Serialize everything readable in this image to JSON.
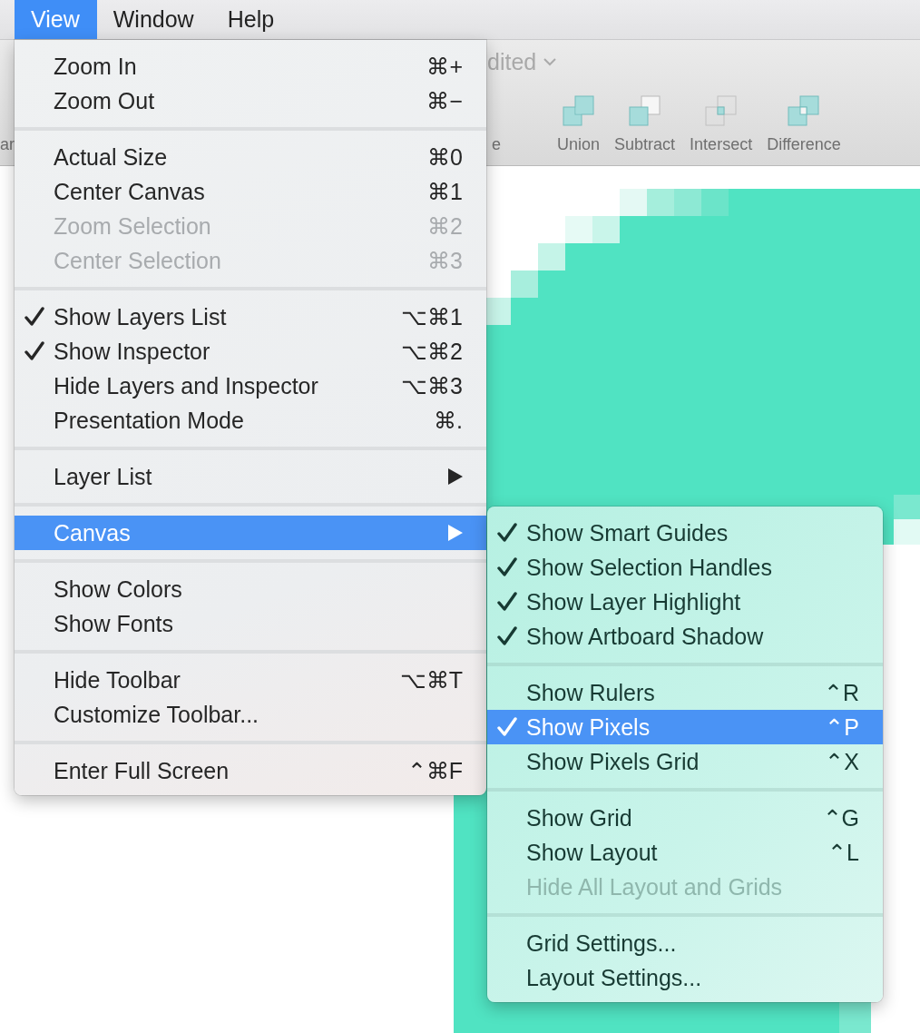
{
  "menubar": {
    "items": [
      {
        "label": "View",
        "selected": true
      },
      {
        "label": "Window",
        "selected": false
      },
      {
        "label": "Help",
        "selected": false
      }
    ]
  },
  "toolbar": {
    "document_title": "dited",
    "left_fragment": "ar",
    "middle_fragment": "e",
    "tools": [
      {
        "label": "Union",
        "kind": "union"
      },
      {
        "label": "Subtract",
        "kind": "subtract"
      },
      {
        "label": "Intersect",
        "kind": "intersect"
      },
      {
        "label": "Difference",
        "kind": "difference"
      }
    ]
  },
  "view_menu": {
    "groups": [
      {
        "items": [
          {
            "label": "Zoom In",
            "shortcut": "⌘+",
            "checked": false,
            "disabled": false,
            "submenu": false,
            "selected": false
          },
          {
            "label": "Zoom Out",
            "shortcut": "⌘−",
            "checked": false,
            "disabled": false,
            "submenu": false,
            "selected": false
          }
        ]
      },
      {
        "items": [
          {
            "label": "Actual Size",
            "shortcut": "⌘0",
            "checked": false,
            "disabled": false,
            "submenu": false,
            "selected": false
          },
          {
            "label": "Center Canvas",
            "shortcut": "⌘1",
            "checked": false,
            "disabled": false,
            "submenu": false,
            "selected": false
          },
          {
            "label": "Zoom Selection",
            "shortcut": "⌘2",
            "checked": false,
            "disabled": true,
            "submenu": false,
            "selected": false
          },
          {
            "label": "Center Selection",
            "shortcut": "⌘3",
            "checked": false,
            "disabled": true,
            "submenu": false,
            "selected": false
          }
        ]
      },
      {
        "items": [
          {
            "label": "Show Layers List",
            "shortcut": "⌥⌘1",
            "checked": true,
            "disabled": false,
            "submenu": false,
            "selected": false
          },
          {
            "label": "Show Inspector",
            "shortcut": "⌥⌘2",
            "checked": true,
            "disabled": false,
            "submenu": false,
            "selected": false
          },
          {
            "label": "Hide Layers and Inspector",
            "shortcut": "⌥⌘3",
            "checked": false,
            "disabled": false,
            "submenu": false,
            "selected": false
          },
          {
            "label": "Presentation Mode",
            "shortcut": "⌘.",
            "checked": false,
            "disabled": false,
            "submenu": false,
            "selected": false
          }
        ]
      },
      {
        "items": [
          {
            "label": "Layer List",
            "checked": false,
            "disabled": false,
            "submenu": true,
            "selected": false
          }
        ]
      },
      {
        "items": [
          {
            "label": "Canvas",
            "checked": false,
            "disabled": false,
            "submenu": true,
            "selected": true
          }
        ]
      },
      {
        "items": [
          {
            "label": "Show Colors",
            "checked": false,
            "disabled": false,
            "submenu": false,
            "selected": false
          },
          {
            "label": "Show Fonts",
            "checked": false,
            "disabled": false,
            "submenu": false,
            "selected": false
          }
        ]
      },
      {
        "items": [
          {
            "label": "Hide Toolbar",
            "shortcut": "⌥⌘T",
            "checked": false,
            "disabled": false,
            "submenu": false,
            "selected": false
          },
          {
            "label": "Customize Toolbar...",
            "checked": false,
            "disabled": false,
            "submenu": false,
            "selected": false
          }
        ]
      },
      {
        "items": [
          {
            "label": "Enter Full Screen",
            "shortcut": "⌃⌘F",
            "checked": false,
            "disabled": false,
            "submenu": false,
            "selected": false
          }
        ]
      }
    ]
  },
  "canvas_submenu": {
    "groups": [
      {
        "items": [
          {
            "label": "Show Smart Guides",
            "checked": true,
            "disabled": false,
            "selected": false
          },
          {
            "label": "Show Selection Handles",
            "checked": true,
            "disabled": false,
            "selected": false
          },
          {
            "label": "Show Layer Highlight",
            "checked": true,
            "disabled": false,
            "selected": false
          },
          {
            "label": "Show Artboard Shadow",
            "checked": true,
            "disabled": false,
            "selected": false
          }
        ]
      },
      {
        "items": [
          {
            "label": "Show Rulers",
            "shortcut": "⌃R",
            "checked": false,
            "disabled": false,
            "selected": false
          },
          {
            "label": "Show Pixels",
            "shortcut": "⌃P",
            "checked": true,
            "disabled": false,
            "selected": true
          },
          {
            "label": "Show Pixels Grid",
            "shortcut": "⌃X",
            "checked": false,
            "disabled": false,
            "selected": false
          }
        ]
      },
      {
        "items": [
          {
            "label": "Show Grid",
            "shortcut": "⌃G",
            "checked": false,
            "disabled": false,
            "selected": false
          },
          {
            "label": "Show Layout",
            "shortcut": "⌃L",
            "checked": false,
            "disabled": false,
            "selected": false
          },
          {
            "label": "Hide All Layout and Grids",
            "checked": false,
            "disabled": true,
            "selected": false
          }
        ]
      },
      {
        "items": [
          {
            "label": "Grid Settings...",
            "checked": false,
            "disabled": false,
            "selected": false
          },
          {
            "label": "Layout Settings...",
            "checked": false,
            "disabled": false,
            "selected": false
          }
        ]
      }
    ]
  }
}
